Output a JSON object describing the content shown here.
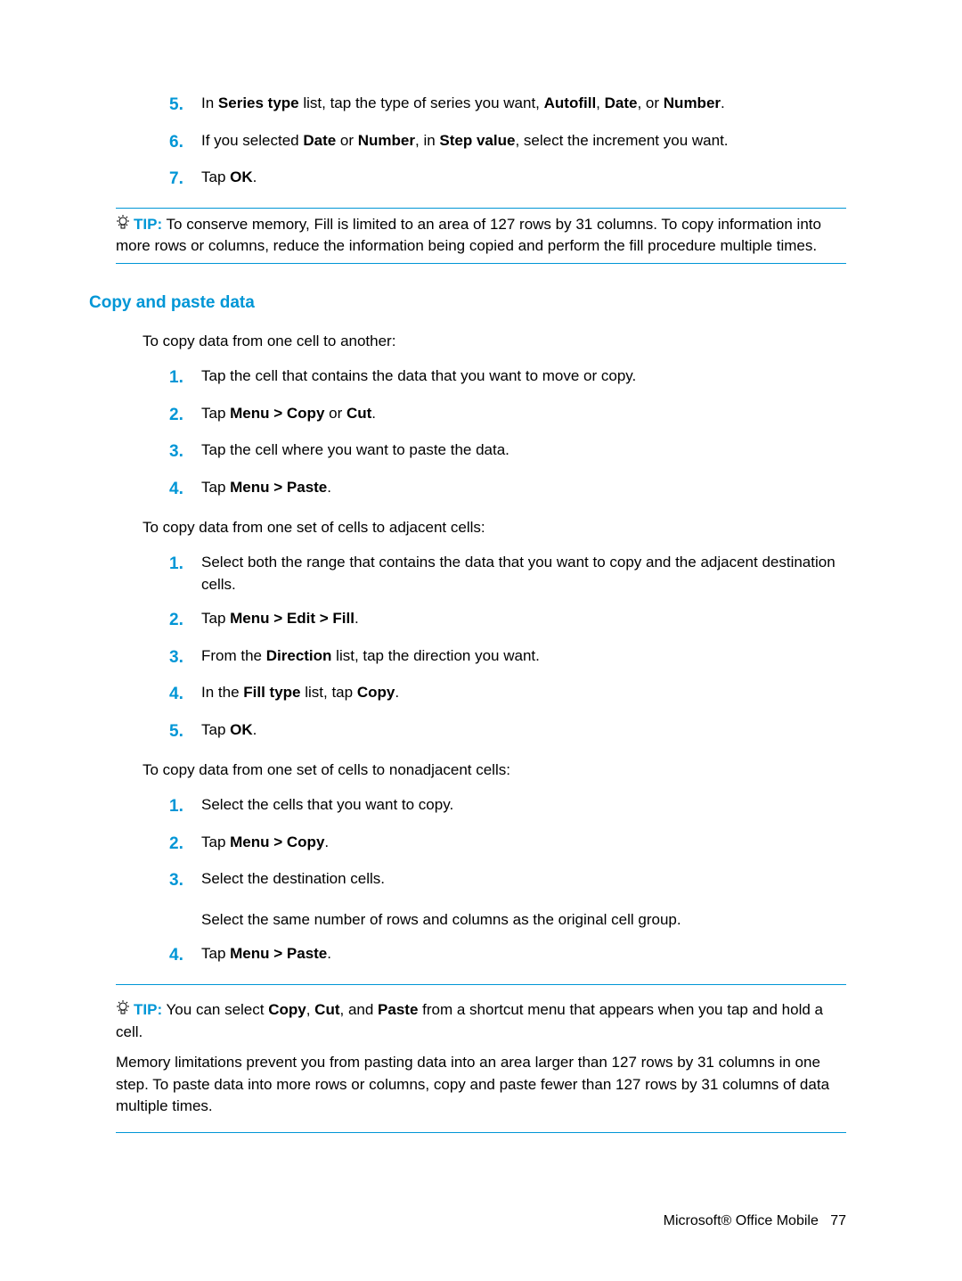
{
  "list1": {
    "n5": "5.",
    "t5_a": "In ",
    "t5_b": "Series type",
    "t5_c": " list, tap the type of series you want, ",
    "t5_d": "Autofill",
    "t5_e": ", ",
    "t5_f": "Date",
    "t5_g": ", or ",
    "t5_h": "Number",
    "t5_i": ".",
    "n6": "6.",
    "t6_a": "If you selected ",
    "t6_b": "Date",
    "t6_c": " or ",
    "t6_d": "Number",
    "t6_e": ", in ",
    "t6_f": "Step value",
    "t6_g": ", select the increment you want.",
    "n7": "7.",
    "t7_a": "Tap ",
    "t7_b": "OK",
    "t7_c": "."
  },
  "tip1": {
    "label": "TIP:",
    "text": "To conserve memory, Fill is limited to an area of 127 rows by 31 columns. To copy information into more rows or columns, reduce the information being copied and perform the fill procedure multiple times."
  },
  "heading1": "Copy and paste data",
  "lead1": "To copy data from one cell to another:",
  "list2": {
    "n1": "1.",
    "t1": "Tap the cell that contains the data that you want to move or copy.",
    "n2": "2.",
    "t2_a": "Tap ",
    "t2_b": "Menu > Copy",
    "t2_c": " or ",
    "t2_d": "Cut",
    "t2_e": ".",
    "n3": "3.",
    "t3": "Tap the cell where you want to paste the data.",
    "n4": "4.",
    "t4_a": "Tap ",
    "t4_b": "Menu > Paste",
    "t4_c": "."
  },
  "lead2": "To copy data from one set of cells to adjacent cells:",
  "list3": {
    "n1": "1.",
    "t1": "Select both the range that contains the data that you want to copy and the adjacent destination cells.",
    "n2": "2.",
    "t2_a": "Tap ",
    "t2_b": "Menu > Edit > Fill",
    "t2_c": ".",
    "n3": "3.",
    "t3_a": "From the ",
    "t3_b": "Direction",
    "t3_c": " list, tap the direction you want.",
    "n4": "4.",
    "t4_a": "In the ",
    "t4_b": "Fill type",
    "t4_c": " list, tap ",
    "t4_d": "Copy",
    "t4_e": ".",
    "n5": "5.",
    "t5_a": "Tap ",
    "t5_b": "OK",
    "t5_c": "."
  },
  "lead3": "To copy data from one set of cells to nonadjacent cells:",
  "list4": {
    "n1": "1.",
    "t1": "Select the cells that you want to copy.",
    "n2": "2.",
    "t2_a": "Tap ",
    "t2_b": "Menu > Copy",
    "t2_c": ".",
    "n3": "3.",
    "t3": "Select the destination cells.",
    "nested": "Select the same number of rows and columns as the original cell group.",
    "n4": "4.",
    "t4_a": "Tap ",
    "t4_b": "Menu > Paste",
    "t4_c": "."
  },
  "tip2": {
    "label": "TIP:",
    "line1_a": "You can select ",
    "line1_b": "Copy",
    "line1_c": ", ",
    "line1_d": "Cut",
    "line1_e": ", and ",
    "line1_f": "Paste",
    "line1_g": " from a shortcut menu that appears when you tap and hold a cell.",
    "line2": "Memory limitations prevent you from pasting data into an area larger than 127 rows by 31 columns in one step. To paste data into more rows or columns, copy and paste fewer than 127 rows by 31 columns of data multiple times."
  },
  "footer_a": "Microsoft® Office Mobile",
  "footer_b": "77"
}
